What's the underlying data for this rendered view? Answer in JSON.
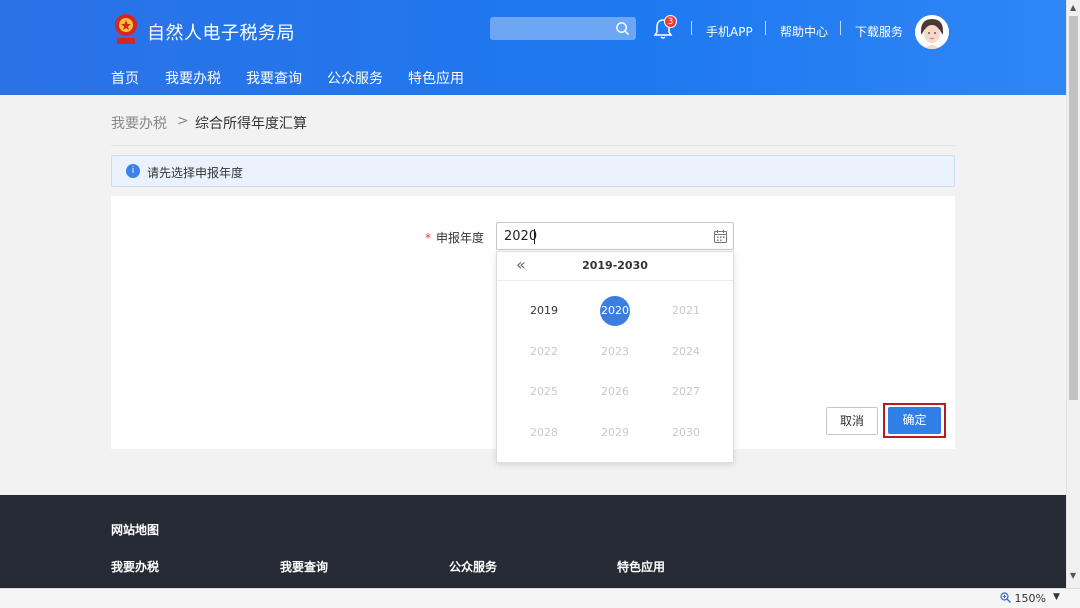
{
  "header": {
    "site_title": "自然人电子税务局",
    "notification_count": "3",
    "links": [
      "手机APP",
      "帮助中心",
      "下载服务"
    ],
    "nav": [
      "首页",
      "我要办税",
      "我要查询",
      "公众服务",
      "特色应用"
    ]
  },
  "breadcrumb": {
    "parent": "我要办税",
    "separator": ">",
    "current": "综合所得年度汇算"
  },
  "alert": {
    "icon_text": "i",
    "message": "请先选择申报年度"
  },
  "form": {
    "required_mark": "*",
    "year_label": "申报年度",
    "year_value": "2020"
  },
  "picker": {
    "prev_symbol": "«",
    "range": "2019-2030",
    "years": [
      {
        "label": "2019",
        "state": "enabled"
      },
      {
        "label": "2020",
        "state": "selected"
      },
      {
        "label": "2021",
        "state": "disabled"
      },
      {
        "label": "2022",
        "state": "disabled"
      },
      {
        "label": "2023",
        "state": "disabled"
      },
      {
        "label": "2024",
        "state": "disabled"
      },
      {
        "label": "2025",
        "state": "disabled"
      },
      {
        "label": "2026",
        "state": "disabled"
      },
      {
        "label": "2027",
        "state": "disabled"
      },
      {
        "label": "2028",
        "state": "disabled"
      },
      {
        "label": "2029",
        "state": "disabled"
      },
      {
        "label": "2030",
        "state": "disabled"
      }
    ]
  },
  "buttons": {
    "cancel": "取消",
    "confirm": "确定"
  },
  "footer": {
    "title": "网站地图",
    "columns": [
      "我要办税",
      "我要查询",
      "公众服务",
      "特色应用"
    ]
  },
  "statusbar": {
    "zoom": "150%",
    "zoom_arrow": "▼"
  },
  "colors": {
    "header_blue": "#1e78f0",
    "primary_button": "#2f7fe6",
    "highlight_border": "#b81c1c",
    "badge_red": "#ee3a3a"
  }
}
